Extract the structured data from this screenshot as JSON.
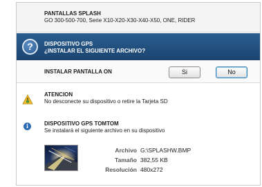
{
  "header": {
    "title": "PANTALLAS SPLASH",
    "subtitle": "GO 300-500-700, Serie X10-X20-X30-X40-X50, ONE, RIDER"
  },
  "banner": {
    "icon": "question-icon",
    "icon_glyph": "?",
    "line1": "DISPOSITIVO GPS",
    "line2": "¿INSTALAR EL SIGUIENTE ARCHIVO?"
  },
  "install": {
    "label": "INSTALAR PANTALLA ON",
    "yes_label": "Si",
    "no_label": "No"
  },
  "warning": {
    "icon": "warning-icon",
    "title": "ATENCION",
    "text": "No desconecte su dispositivo o retire la Tarjeta SD"
  },
  "info": {
    "icon": "info-icon",
    "icon_glyph": "i",
    "title": "DISPOSITIVO GPS TOMTOM",
    "text": "Se instalará el siguiente archivo en su dispositivo"
  },
  "file": {
    "archivo_label": "Archivo",
    "archivo_value": "G:\\SPLASHW.BMP",
    "tamano_label": "Tamaño",
    "tamano_value": "382,55 KB",
    "resolucion_label": "Resolución",
    "resolucion_value": "480x272"
  },
  "colors": {
    "banner": "#1f4d7a",
    "accent_button_border": "#3c7fb1",
    "info_icon": "#2d6bb5",
    "warning_icon": "#f0c02c"
  }
}
